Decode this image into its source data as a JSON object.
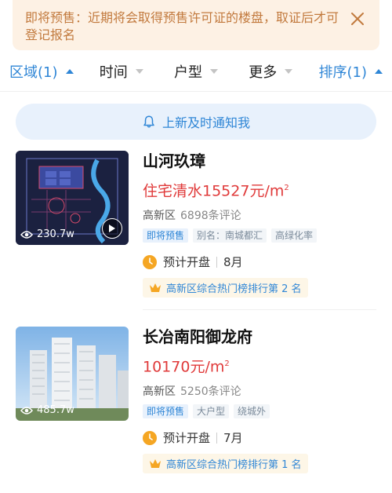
{
  "notice": {
    "text": "即将预售：近期将会取得预售许可证的楼盘，取证后才可登记报名",
    "close_icon": "close-icon"
  },
  "filters": [
    {
      "label": "区域(1)",
      "active": true
    },
    {
      "label": "时间",
      "active": false
    },
    {
      "label": "户型",
      "active": false
    },
    {
      "label": "更多",
      "active": false
    },
    {
      "label": "排序(1)",
      "active": true
    }
  ],
  "notify_button": {
    "label": "上新及时通知我",
    "icon": "bell-icon"
  },
  "listings": [
    {
      "name": "山河玖璋",
      "price": "住宅清水15527元/m",
      "price_sup": "2",
      "district": "高新区",
      "reviews": "6898条评论",
      "views": "230.7w",
      "tags": [
        "即将预售",
        "别名：南城都汇",
        "高绿化率"
      ],
      "open_label": "预计开盘",
      "open_month": "8月",
      "rank": "高新区综合热门榜排行第 2 名",
      "has_video": true
    },
    {
      "name": "长冶南阳御龙府",
      "price": "10170元/m",
      "price_sup": "2",
      "district": "高新区",
      "reviews": "5250条评论",
      "views": "485.7w",
      "tags": [
        "即将预售",
        "大户型",
        "绕城外"
      ],
      "open_label": "预计开盘",
      "open_month": "7月",
      "rank": "高新区综合热门榜排行第 1 名",
      "has_video": false
    }
  ],
  "colors": {
    "accent": "#2f86d6",
    "price": "#e03a3a",
    "notice_bg": "#fdf1e4",
    "notice_text": "#c27a3e"
  }
}
